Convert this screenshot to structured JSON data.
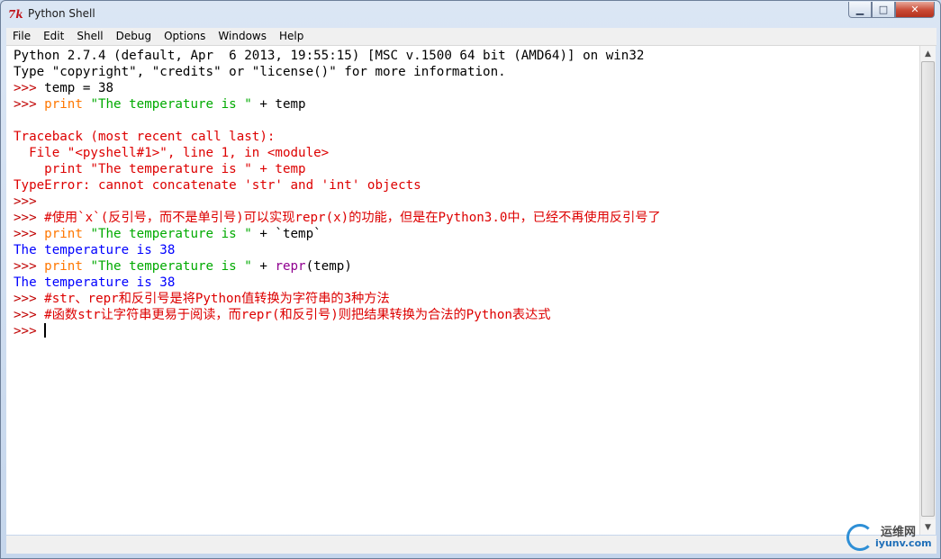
{
  "window": {
    "title": "Python Shell"
  },
  "menus": [
    "File",
    "Edit",
    "Shell",
    "Debug",
    "Options",
    "Windows",
    "Help"
  ],
  "caption_buttons": {
    "minimize": "▁",
    "maximize": "□",
    "close": "✕"
  },
  "colors": {
    "stdout": "#000000",
    "prompt": "#c00000",
    "keyword": "#ff7700",
    "string": "#00aa00",
    "error": "#dd0000",
    "output": "#0000ff",
    "comment": "#dd0000",
    "builtin": "#900090"
  },
  "lines": [
    [
      [
        "Python 2.7.4 (default, Apr  6 2013, 19:55:15) [MSC v.1500 64 bit (AMD64)] on win32",
        "#000000"
      ]
    ],
    [
      [
        "Type \"copyright\", \"credits\" or \"license()\" for more information.",
        "#000000"
      ]
    ],
    [
      [
        ">>> ",
        "#c00000"
      ],
      [
        "temp = 38",
        "#000000"
      ]
    ],
    [
      [
        ">>> ",
        "#c00000"
      ],
      [
        "print",
        "#ff7700"
      ],
      [
        " ",
        "#000000"
      ],
      [
        "\"The temperature is \"",
        "#00aa00"
      ],
      [
        " + temp",
        "#000000"
      ]
    ],
    [
      [
        "",
        "#000000"
      ]
    ],
    [
      [
        "Traceback (most recent call last):",
        "#dd0000"
      ]
    ],
    [
      [
        "  File \"<pyshell#1>\", line 1, in <module>",
        "#dd0000"
      ]
    ],
    [
      [
        "    print \"The temperature is \" + temp",
        "#dd0000"
      ]
    ],
    [
      [
        "TypeError: cannot concatenate 'str' and 'int' objects",
        "#dd0000"
      ]
    ],
    [
      [
        ">>> ",
        "#c00000"
      ]
    ],
    [
      [
        ">>> ",
        "#c00000"
      ],
      [
        "#使用`x`(反引号，而不是单引号)可以实现repr(x)的功能，但是在Python3.0中，已经不再使用反引号了",
        "#dd0000"
      ]
    ],
    [
      [
        ">>> ",
        "#c00000"
      ],
      [
        "print",
        "#ff7700"
      ],
      [
        " ",
        "#000000"
      ],
      [
        "\"The temperature is \"",
        "#00aa00"
      ],
      [
        " + `temp`",
        "#000000"
      ]
    ],
    [
      [
        "The temperature is 38",
        "#0000ff"
      ]
    ],
    [
      [
        ">>> ",
        "#c00000"
      ],
      [
        "print",
        "#ff7700"
      ],
      [
        " ",
        "#000000"
      ],
      [
        "\"The temperature is \"",
        "#00aa00"
      ],
      [
        " + ",
        "#000000"
      ],
      [
        "repr",
        "#900090"
      ],
      [
        "(temp)",
        "#000000"
      ]
    ],
    [
      [
        "The temperature is 38",
        "#0000ff"
      ]
    ],
    [
      [
        ">>> ",
        "#c00000"
      ],
      [
        "#str、repr和反引号是将Python值转换为字符串的3种方法",
        "#dd0000"
      ]
    ],
    [
      [
        ">>> ",
        "#c00000"
      ],
      [
        "#函数str让字符串更易于阅读，而repr(和反引号)则把结果转换为合法的Python表达式",
        "#dd0000"
      ]
    ],
    [
      [
        ">>> ",
        "#c00000"
      ]
    ]
  ],
  "watermark": {
    "text_cn": "运维网",
    "url": "iyunv.com"
  }
}
